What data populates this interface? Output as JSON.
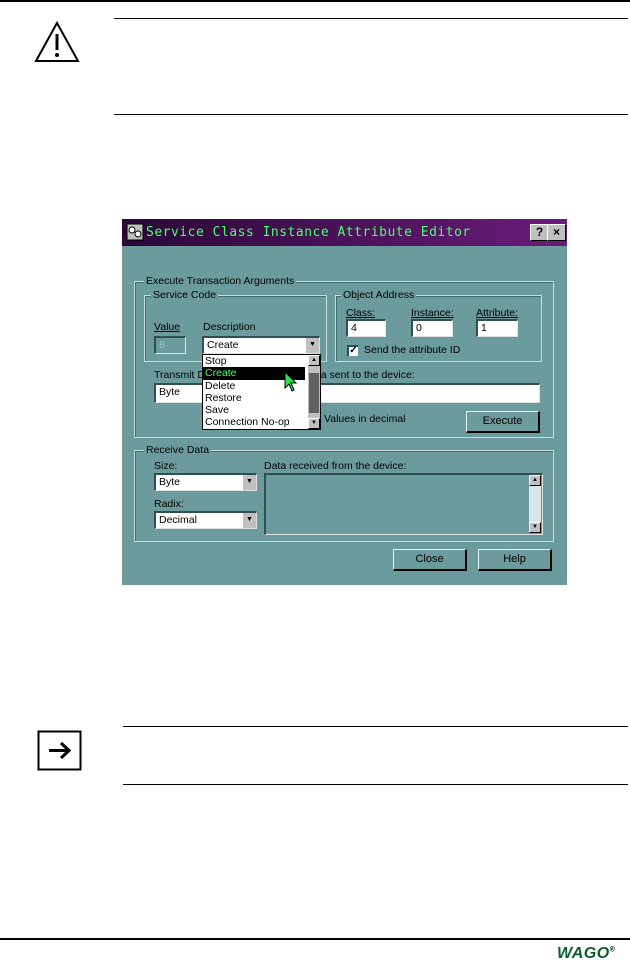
{
  "dialog": {
    "title": "Service Class Instance Attribute Editor",
    "help_btn": "?",
    "close_btn": "×",
    "execute_group": "Execute Transaction Arguments",
    "service_code_group": "Service Code",
    "value_label": "Value",
    "value": "8",
    "description_label": "Description",
    "description_value": "Create",
    "description_options": [
      "Stop",
      "Create",
      "Delete",
      "Restore",
      "Save",
      "Connection No-op"
    ],
    "object_address_group": "Object Address",
    "class_label": "Class:",
    "class_value": "4",
    "instance_label": "Instance:",
    "instance_value": "0",
    "attribute_label": "Attribute:",
    "attribute_value": "1",
    "send_attr_label": "Send the attribute ID",
    "transmit_label_start": "Transmit D",
    "transmit_label_end": "ata sent to the device:",
    "transmit_size_value": "Byte",
    "values_decimal_label": "Values in decimal",
    "execute_btn": "Execute",
    "receive_group": "Receive Data",
    "size_label": "Size:",
    "size_value": "Byte",
    "radix_label": "Radix:",
    "radix_value": "Decimal",
    "received_label": "Data received from the device:",
    "close_button": "Close",
    "help_button": "Help"
  },
  "footer": {
    "logo": "WAGO",
    "registered": "®"
  },
  "icons": [
    "warning-icon",
    "arrow-right-icon",
    "mouse-cursor-icon"
  ]
}
